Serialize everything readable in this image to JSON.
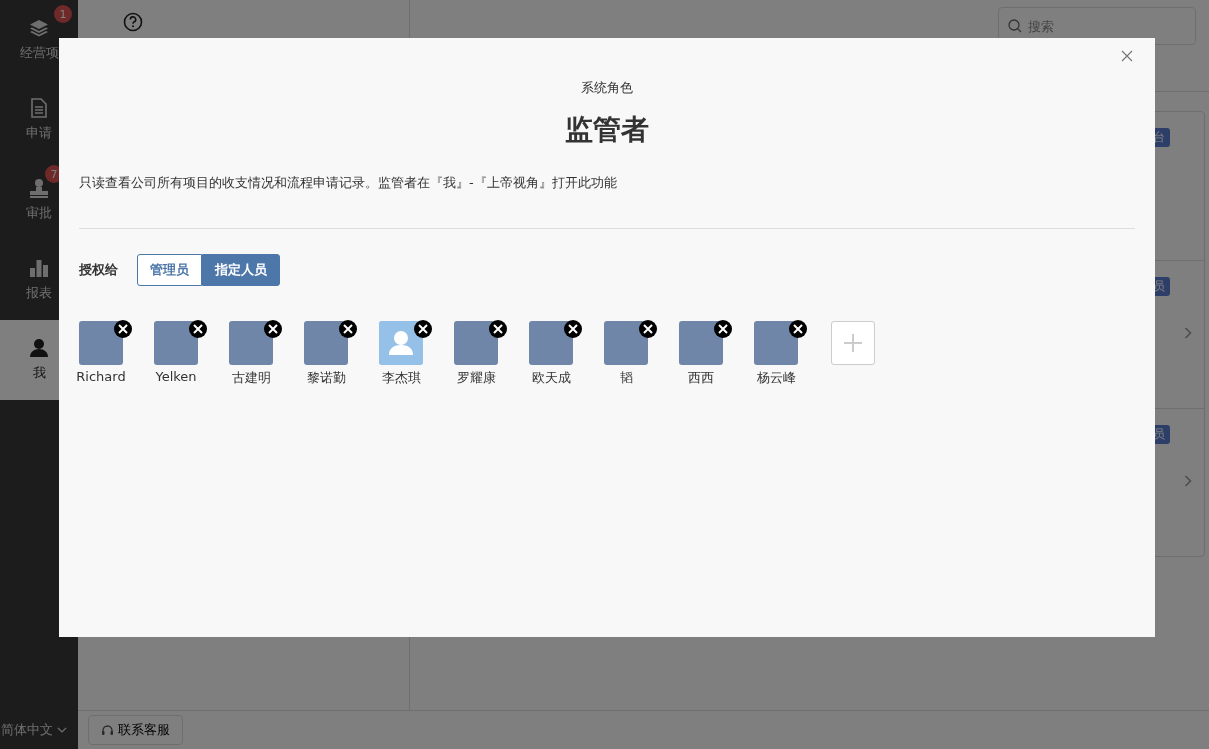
{
  "sidebar": {
    "items": [
      {
        "label": "经营项",
        "badge": "1",
        "selected": false
      },
      {
        "label": "申请",
        "selected": false
      },
      {
        "label": "审批",
        "badge": "7",
        "selected": false
      },
      {
        "label": "报表",
        "selected": false
      },
      {
        "label": "我",
        "selected": true
      }
    ],
    "language": "简体中文"
  },
  "background": {
    "search": {
      "placeholder": "搜索"
    },
    "cards": [
      {
        "tag": "台",
        "chevron": false
      },
      {
        "tag": "员",
        "chevron": true
      },
      {
        "tag": "员",
        "chevron": true
      }
    ],
    "support_button": "联系客服"
  },
  "modal": {
    "subtitle": "系统角色",
    "title": "监管者",
    "description": "只读查看公司所有项目的收支情况和流程申请记录。监管者在『我』-『上帝视角』打开此功能",
    "grant_label": "授权给",
    "grant_options": [
      {
        "label": "管理员",
        "selected": false
      },
      {
        "label": "指定人员",
        "selected": true
      }
    ],
    "members": [
      {
        "name": "Richard",
        "kind": "photo"
      },
      {
        "name": "Yelken",
        "kind": "photo"
      },
      {
        "name": "古建明",
        "kind": "photo"
      },
      {
        "name": "黎诺勤",
        "kind": "photo"
      },
      {
        "name": "李杰琪",
        "kind": "default"
      },
      {
        "name": "罗耀康",
        "kind": "photo"
      },
      {
        "name": "欧天成",
        "kind": "photo"
      },
      {
        "name": "韬",
        "kind": "photo"
      },
      {
        "name": "西西",
        "kind": "photo"
      },
      {
        "name": "杨云峰",
        "kind": "photo"
      }
    ]
  }
}
